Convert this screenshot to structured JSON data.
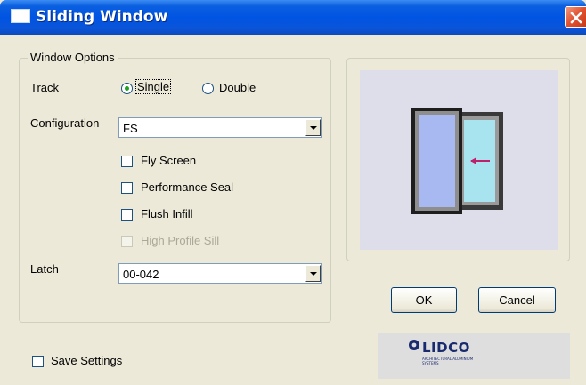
{
  "window": {
    "title": "Sliding Window"
  },
  "options": {
    "group_label": "Window Options",
    "track_label": "Track",
    "track_options": [
      {
        "label": "Single",
        "selected": true
      },
      {
        "label": "Double",
        "selected": false
      }
    ],
    "configuration_label": "Configuration",
    "configuration_value": "FS",
    "checkboxes": [
      {
        "label": "Fly Screen",
        "checked": false,
        "enabled": true
      },
      {
        "label": "Performance Seal",
        "checked": false,
        "enabled": true
      },
      {
        "label": "Flush Infill",
        "checked": false,
        "enabled": true
      },
      {
        "label": "High Profile Sill",
        "checked": false,
        "enabled": false
      }
    ],
    "latch_label": "Latch",
    "latch_value": "00-042"
  },
  "save_settings": {
    "label": "Save Settings",
    "checked": false
  },
  "buttons": {
    "ok": "OK",
    "cancel": "Cancel"
  },
  "logo": {
    "name": "LIDCO",
    "tagline": "ARCHITECTURAL ALUMINIUM SYSTEMS"
  },
  "colors": {
    "titlebar": "#0054e3",
    "sash_blue": "#a8b8f0",
    "sash_cyan": "#a8e4f0",
    "arrow": "#c0206a"
  }
}
